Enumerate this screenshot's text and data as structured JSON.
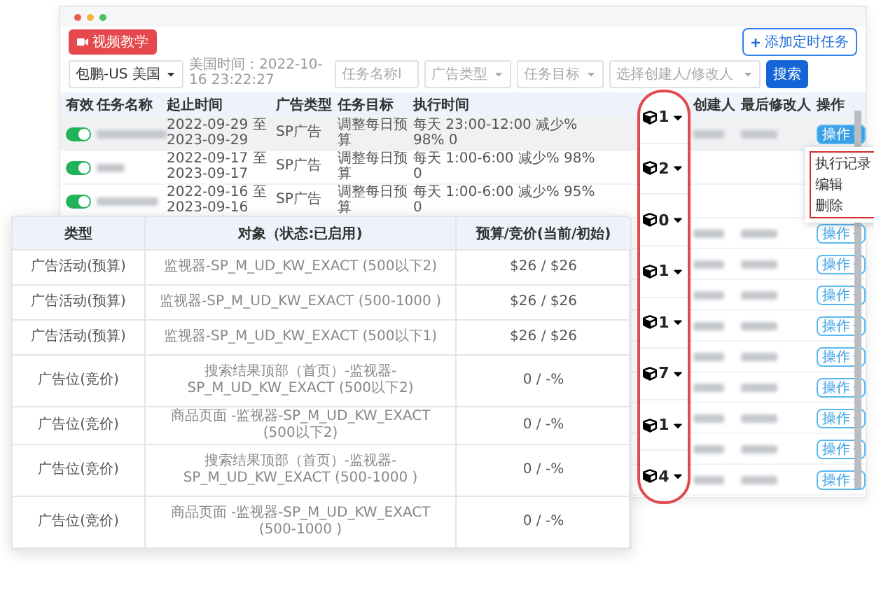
{
  "toolbar": {
    "tutorial_button": "视频教学",
    "add_button": "添加定时任务"
  },
  "filters": {
    "store_select": "包鹏-US 美国",
    "time_text": "美国时间：2022-10-16 23:22:27",
    "name_placeholder": "任务名称l",
    "ad_type_placeholder": "广告类型",
    "goal_placeholder": "任务目标",
    "person_placeholder": "选择创建人/修改人",
    "search_button": "搜索"
  },
  "table": {
    "columns": [
      "有效",
      "任务名称",
      "起止时间",
      "广告类型",
      "任务目标",
      "执行时间",
      "创建人",
      "最后修改人",
      "操作"
    ],
    "rows": [
      {
        "kind": "full",
        "enabled": true,
        "hovered": true,
        "period": "2022-09-29 至 2023-09-29",
        "ad_type": "SP广告",
        "goal": "调整每日预算",
        "schedule": "每天 23:00-12:00 减少% 98% 0",
        "action": "操作",
        "menu_open": true
      },
      {
        "kind": "full",
        "enabled": true,
        "hovered": false,
        "period": "2022-09-17 至 2023-09-17",
        "ad_type": "SP广告",
        "goal": "调整每日预算",
        "schedule": "每天 1:00-6:00 减少% 98% 0"
      },
      {
        "kind": "full",
        "enabled": true,
        "hovered": false,
        "period": "2022-09-16 至 2023-09-16",
        "ad_type": "SP广告",
        "goal": "调整每日预算",
        "schedule": "每天 1:00-6:00 减少% 95% 0"
      },
      {
        "kind": "covered",
        "action": "操作",
        "menu_open": false
      },
      {
        "kind": "covered",
        "action": "操作",
        "menu_open": false
      },
      {
        "kind": "covered",
        "action": "操作",
        "menu_open": false
      },
      {
        "kind": "covered",
        "action": "操作",
        "menu_open": false
      },
      {
        "kind": "covered",
        "action": "操作",
        "menu_open": false
      },
      {
        "kind": "covered",
        "action": "操作",
        "menu_open": false
      },
      {
        "kind": "covered",
        "action": "操作",
        "menu_open": false
      },
      {
        "kind": "covered",
        "action": "操作",
        "menu_open": false
      },
      {
        "kind": "covered",
        "action": "操作",
        "menu_open": false
      }
    ]
  },
  "action_menu": [
    "执行记录",
    "编辑",
    "删除"
  ],
  "object_counts": [
    "1",
    "2",
    "0",
    "1",
    "1",
    "7",
    "1",
    "4"
  ],
  "detail_table": {
    "columns": [
      "类型",
      "对象（状态:已启用)",
      "预算/竞价(当前/初始)"
    ],
    "rows": [
      {
        "type": "广告活动(预算)",
        "object": "监视器-SP_M_UD_KW_EXACT (500以下2)",
        "budget": "$26 / $26"
      },
      {
        "type": "广告活动(预算)",
        "object": "监视器-SP_M_UD_KW_EXACT (500-1000 )",
        "budget": "$26 / $26"
      },
      {
        "type": "广告活动(预算)",
        "object": "监视器-SP_M_UD_KW_EXACT (500以下1)",
        "budget": "$26 / $26"
      },
      {
        "type": "广告位(竞价)",
        "object": "搜索结果顶部（首页）-监视器-SP_M_UD_KW_EXACT (500以下2)",
        "budget": "0 / -%"
      },
      {
        "type": "广告位(竞价)",
        "object": "商品页面 -监视器-SP_M_UD_KW_EXACT (500以下2)",
        "budget": "0 / -%"
      },
      {
        "type": "广告位(竞价)",
        "object": "搜索结果顶部（首页）-监视器-SP_M_UD_KW_EXACT (500-1000 )",
        "budget": "0 / -%"
      },
      {
        "type": "广告位(竞价)",
        "object": "商品页面 -监视器-SP_M_UD_KW_EXACT (500-1000 )",
        "budget": "0 / -%"
      }
    ]
  }
}
